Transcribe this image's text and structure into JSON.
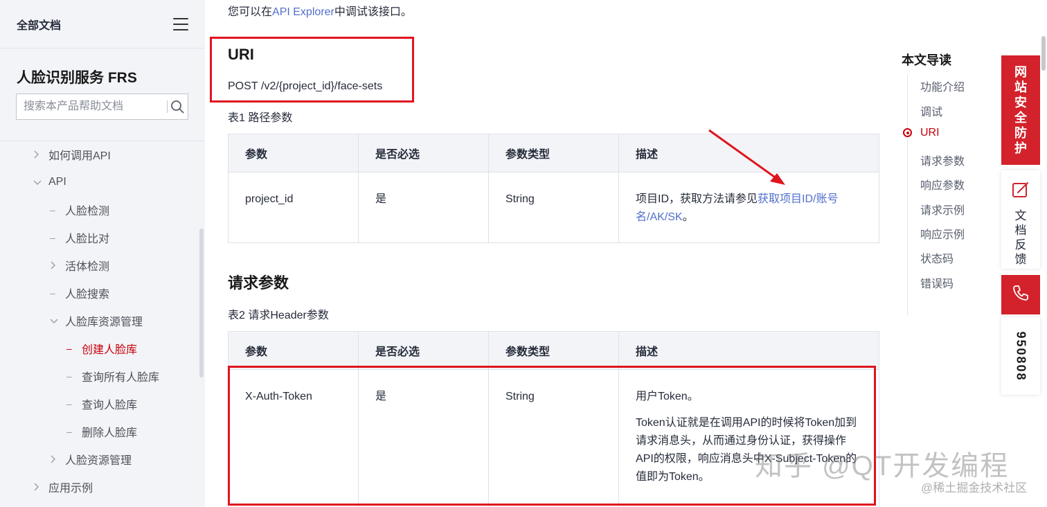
{
  "sidebar": {
    "all_docs": "全部文档",
    "product_title": "人脸识别服务 FRS",
    "search_placeholder": "搜索本产品帮助文档",
    "items": [
      {
        "label": "如何调用API"
      },
      {
        "label": "API"
      },
      {
        "label": "人脸检测"
      },
      {
        "label": "人脸比对"
      },
      {
        "label": "活体检测"
      },
      {
        "label": "人脸搜索"
      },
      {
        "label": "人脸库资源管理"
      },
      {
        "label": "创建人脸库"
      },
      {
        "label": "查询所有人脸库"
      },
      {
        "label": "查询人脸库"
      },
      {
        "label": "删除人脸库"
      },
      {
        "label": "人脸资源管理"
      },
      {
        "label": "应用示例"
      }
    ]
  },
  "main": {
    "intro_prefix": "您可以在",
    "intro_link": "API Explorer",
    "intro_suffix": "中调试该接口。",
    "uri_heading": "URI",
    "uri_method": "POST",
    "uri_path": "/v2/{project_id}/face-sets",
    "table1_caption": "表1 路径参数",
    "table1": {
      "headers": [
        "参数",
        "是否必选",
        "参数类型",
        "描述"
      ],
      "rows": [
        {
          "param": "project_id",
          "required": "是",
          "type": "String",
          "desc_prefix": "项目ID，获取方法请参见",
          "desc_link": "获取项目ID/账号名/AK/SK",
          "desc_suffix": "。"
        }
      ]
    },
    "req_heading": "请求参数",
    "table2_caption": "表2 请求Header参数",
    "table2": {
      "headers": [
        "参数",
        "是否必选",
        "参数类型",
        "描述"
      ],
      "rows": [
        {
          "param": "X-Auth-Token",
          "required": "是",
          "type": "String",
          "desc_1": "用户Token。",
          "desc_2": "Token认证就是在调用API的时候将Token加到请求消息头，从而通过身份认证，获得操作API的权限，响应消息头中X-Subject-Token的值即为Token。"
        }
      ]
    }
  },
  "toc": {
    "title": "本文导读",
    "items": [
      {
        "label": "功能介绍"
      },
      {
        "label": "调试"
      },
      {
        "label": "URI",
        "active": true
      },
      {
        "label": "请求参数"
      },
      {
        "label": "响应参数"
      },
      {
        "label": "请求示例"
      },
      {
        "label": "响应示例"
      },
      {
        "label": "状态码"
      },
      {
        "label": "错误码"
      }
    ]
  },
  "float_bar": {
    "security": "网站安全防护",
    "feedback": "文档反馈",
    "hotline": "950808",
    "phone_icon": "phone-icon",
    "feedback_icon": "edit-icon"
  },
  "watermark": {
    "main": "知乎 @QT开发编程",
    "sub": "@稀土掘金技术社区"
  },
  "colors": {
    "accent_red": "#c7000b",
    "link_blue": "#526ecc",
    "annotation_red": "#e0141e"
  }
}
